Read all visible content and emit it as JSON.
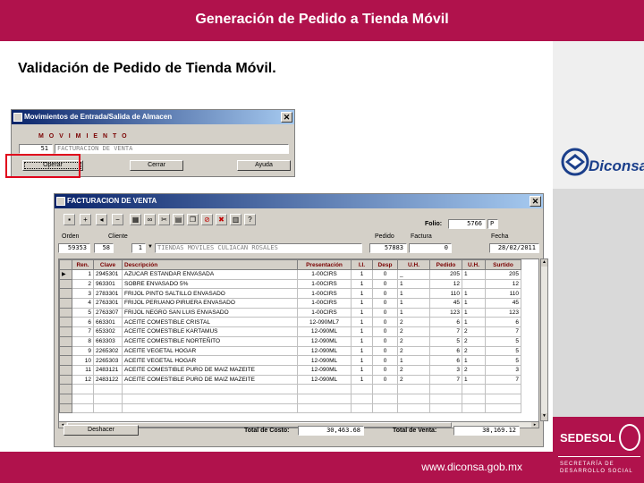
{
  "slide": {
    "title": "Generación de Pedido a Tienda Móvil",
    "subtitle": "Validación de Pedido de Tienda Móvil.",
    "footer_url": "www.diconsa.gob.mx",
    "diconsa_logo": "Diconsa",
    "sedesol_logo": "SEDESOL",
    "sedesol_sub1": "SECRETARÍA DE",
    "sedesol_sub2": "DESARROLLO SOCIAL"
  },
  "movimientos": {
    "title": "Movimientos de Entrada/Salida de Almacen",
    "heading": "M O V I M I E N T O",
    "code": "51",
    "description": "FACTURACION DE VENTA",
    "buttons": {
      "operar": "Operar",
      "cerrar": "Cerrar",
      "ayuda": "Ayuda"
    }
  },
  "facturacion": {
    "title": "FACTURACION DE VENTA",
    "toolbar_icons": [
      "save-icon",
      "new-record-icon",
      "first-record-icon",
      "delete-icon",
      "grid-icon",
      "binoculars-icon",
      "cut-icon",
      "print-icon",
      "copy-icon",
      "cancel-icon",
      "exit-icon",
      "calendar-icon",
      "help-icon"
    ],
    "folio_label": "Folio:",
    "folio_value": "5766",
    "folio_suffix": "P",
    "labels": {
      "orden": "Orden",
      "cliente": "Cliente",
      "pedido": "Pedido",
      "factura": "Factura",
      "fecha": "Fecha"
    },
    "orden": "59353",
    "cliente_num": "58",
    "cliente_code": "1",
    "cliente_name": "TIENDAS MOVILES CULIACAN ROSALES",
    "pedido": "57883",
    "factura": "0",
    "fecha": "28/02/2011",
    "grid": {
      "headers": [
        "Ren.",
        "Clave",
        "Descripción",
        "Presentación",
        "I.I.",
        "Desp",
        "U.H.",
        "Pedido",
        "U.H.",
        "Surtido"
      ],
      "rows": [
        [
          "1",
          "2945301",
          "AZUCAR ESTANDAR ENVASADA",
          "1-00CIRS",
          "1",
          "0",
          "_",
          "205",
          "1",
          "205"
        ],
        [
          "2",
          "963301",
          "SOBRE ENVASADO 5%",
          "1-00CIRS",
          "1",
          "0",
          "1",
          "12",
          "",
          "12"
        ],
        [
          "3",
          "2783301",
          "FRIJOL PINTO SALTILLO ENVASADO",
          "1-00CIRS",
          "1",
          "0",
          "1",
          "110",
          "1",
          "110"
        ],
        [
          "4",
          "2763301",
          "FRIJOL PERUANO PIRUERA ENVASADO",
          "1-00CIRS",
          "1",
          "0",
          "1",
          "45",
          "1",
          "45"
        ],
        [
          "5",
          "2763307",
          "FRIJOL NEGRO SAN LUIS ENVASADO",
          "1-00CIRS",
          "1",
          "0",
          "1",
          "123",
          "1",
          "123"
        ],
        [
          "6",
          "663301",
          "ACEITE COMESTIBLE CRISTAL",
          "12-090ML7",
          "1",
          "0",
          "2",
          "6",
          "1",
          "6"
        ],
        [
          "7",
          "653302",
          "ACEITE COMESTIBLE KARTAMUS",
          "12-090ML",
          "1",
          "0",
          "2",
          "7",
          "2",
          "7"
        ],
        [
          "8",
          "663303",
          "ACEITE COMESTIBLE NORTEÑITO",
          "12-090ML",
          "1",
          "0",
          "2",
          "5",
          "2",
          "5"
        ],
        [
          "9",
          "2265302",
          "ACEITE VEGETAL HOGAR",
          "12-090ML",
          "1",
          "0",
          "2",
          "6",
          "2",
          "5"
        ],
        [
          "10",
          "2265303",
          "ACEITE VEGETAL HOGAR",
          "12-090ML",
          "1",
          "0",
          "1",
          "6",
          "1",
          "5"
        ],
        [
          "11",
          "2483121",
          "ACEITE COMESTIBLE PURO DE MAIZ MAZEITE",
          "12-090ML",
          "1",
          "0",
          "2",
          "3",
          "2",
          "3"
        ],
        [
          "12",
          "2483122",
          "ACEITE COMESTIBLE PURO DE MAIZ MAZEITE",
          "12-090ML",
          "1",
          "0",
          "2",
          "7",
          "1",
          "7"
        ],
        [
          "",
          "",
          "",
          "",
          "",
          "",
          "",
          "",
          "",
          ""
        ],
        [
          "",
          "",
          "",
          "",
          "",
          "",
          "",
          "",
          "",
          ""
        ],
        [
          "",
          "",
          "",
          "",
          "",
          "",
          "",
          "",
          "",
          ""
        ]
      ]
    },
    "deshacer": "Deshacer",
    "total_costo_label": "Total de Costo:",
    "total_costo": "30,463.68",
    "total_venta_label": "Total de Venta:",
    "total_venta": "38,169.12"
  }
}
